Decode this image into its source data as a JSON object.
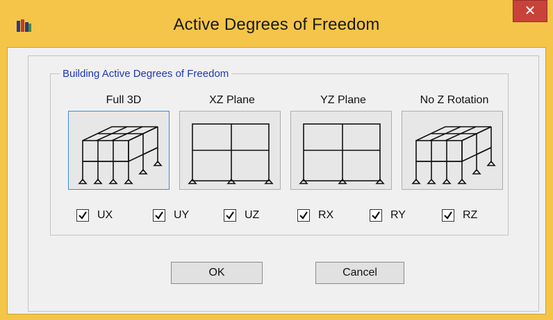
{
  "window": {
    "title": "Active Degrees of Freedom",
    "close_symbol": "✕",
    "app_icon": "etabs-app-icon"
  },
  "group": {
    "label": "Building Active Degrees of Freedom"
  },
  "presets": [
    {
      "label": "Full 3D",
      "icon": "full-3d-frame-icon",
      "selected": true
    },
    {
      "label": "XZ Plane",
      "icon": "xz-plane-frame-icon",
      "selected": false
    },
    {
      "label": "YZ Plane",
      "icon": "yz-plane-frame-icon",
      "selected": false
    },
    {
      "label": "No Z Rotation",
      "icon": "no-z-rotation-frame-icon",
      "selected": false
    }
  ],
  "dofs": [
    {
      "label": "UX",
      "checked": true
    },
    {
      "label": "UY",
      "checked": true
    },
    {
      "label": "UZ",
      "checked": true
    },
    {
      "label": "RX",
      "checked": true
    },
    {
      "label": "RY",
      "checked": true
    },
    {
      "label": "RZ",
      "checked": true
    }
  ],
  "buttons": {
    "ok": "OK",
    "cancel": "Cancel"
  },
  "colors": {
    "title_bar": "#f4c549",
    "close_button": "#c8423a",
    "group_label": "#1d37b5",
    "selection_border": "#3a8be0"
  }
}
